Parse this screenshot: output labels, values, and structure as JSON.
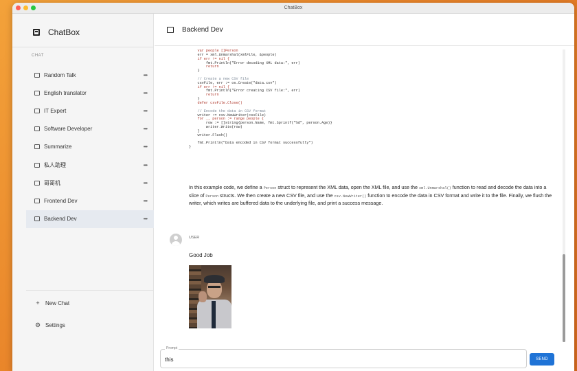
{
  "window": {
    "title": "ChatBox"
  },
  "sidebar": {
    "brand": "ChatBox",
    "section_label": "CHAT",
    "items": [
      {
        "label": "Random Talk",
        "active": false
      },
      {
        "label": "English translator",
        "active": false
      },
      {
        "label": "IT Expert",
        "active": false
      },
      {
        "label": "Software Developer",
        "active": false
      },
      {
        "label": "Summarize",
        "active": false
      },
      {
        "label": "私人助理",
        "active": false
      },
      {
        "label": "哥哥机",
        "active": false
      },
      {
        "label": "Frontend Dev",
        "active": false
      },
      {
        "label": "Backend Dev",
        "active": true
      }
    ],
    "more_glyph": "•••",
    "new_chat": "New Chat",
    "settings": "Settings"
  },
  "main": {
    "header_title": "Backend Dev",
    "code_lines": [
      "    var people []Person",
      "    err = xml.Unmarshal(xmlFile, &people)",
      "    if err != nil {",
      "        fmt.Println(\"Error decoding XML data:\", err)",
      "        return",
      "    }",
      "",
      "    // Create a new CSV file",
      "    csvFile, err := os.Create(\"data.csv\")",
      "    if err != nil {",
      "        fmt.Println(\"Error creating CSV file:\", err)",
      "        return",
      "    }",
      "    defer csvFile.Close()",
      "",
      "    // Encode the data in CSV format",
      "    writer := csv.NewWriter(csvFile)",
      "    for _, person := range people {",
      "        row := []string{person.Name, fmt.Sprintf(\"%d\", person.Age)}",
      "        writer.Write(row)",
      "    }",
      "    writer.Flush()",
      "",
      "    fmt.Println(\"Data encoded in CSV format successfully\")",
      "}"
    ],
    "paragraph": {
      "p1": "In this example code, we define a ",
      "c1": "Person",
      "p2": " struct to represent the XML data, open the XML file, and use the ",
      "c2": "xml.Unmarshal()",
      "p3": " function to read and decode the data into a slice of ",
      "c3": "Person",
      "p4": " structs. We then create a new CSV file, and use the ",
      "c4": "csv.NewWriter()",
      "p5": " function to encode the data in CSV format and write it to the file. Finally, we flush the writer, which writes are buffered data to the underlying file, and print a success message."
    },
    "user_message": {
      "username": "USER",
      "text": "Good Job"
    },
    "prompt": {
      "legend": "Prompt",
      "value": "this"
    },
    "send_label": "SEND"
  }
}
